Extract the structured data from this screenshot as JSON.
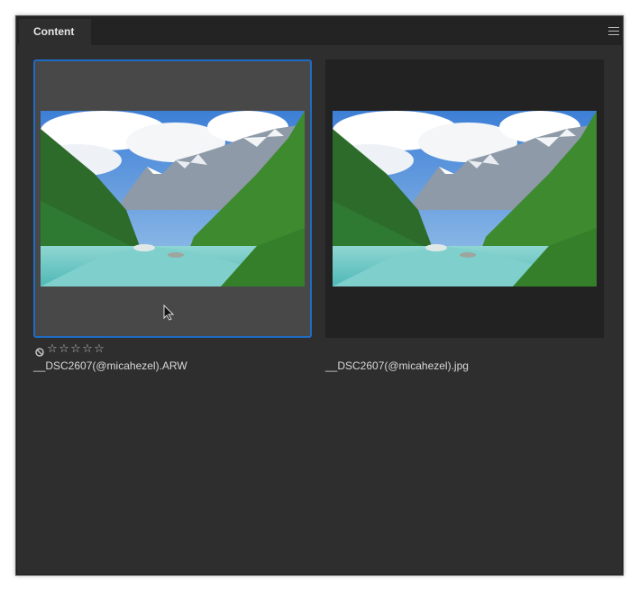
{
  "panel": {
    "tab_label": "Content",
    "menu_icon": "hamburger-menu-icon"
  },
  "items": [
    {
      "filename": "__DSC2607(@micahezel).ARW",
      "selected": true,
      "rating_stars": 0,
      "reject_icon": "reject-circle-icon"
    },
    {
      "filename": "__DSC2607(@micahezel).jpg",
      "selected": false
    }
  ],
  "colors": {
    "selection": "#1f6cc4",
    "panel_bg": "#2e2e2e"
  }
}
